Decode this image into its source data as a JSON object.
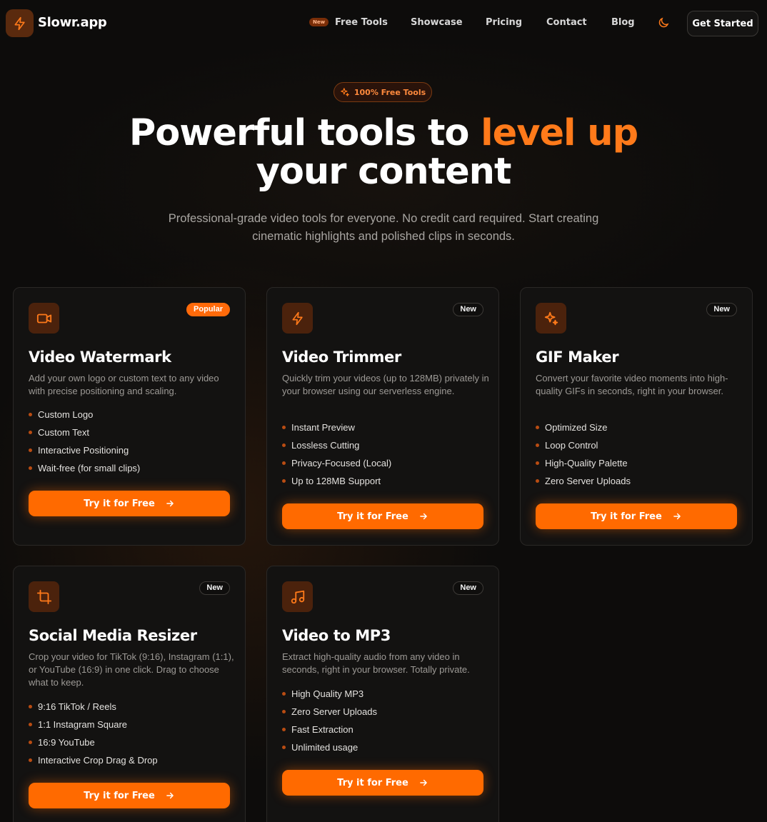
{
  "brand": {
    "name": "Slowr.app",
    "icon": "bolt-icon"
  },
  "nav": {
    "new_badge": "New",
    "links": [
      "Free Tools",
      "Showcase",
      "Pricing",
      "Contact",
      "Blog"
    ],
    "theme_icon": "moon-icon",
    "cta": "Get Started"
  },
  "hero": {
    "badge": "100% Free Tools",
    "title_part1": "Powerful tools to ",
    "title_accent": "level up",
    "title_part2": "your content",
    "subtitle": "Professional-grade video tools for everyone. No credit card required. Start creating cinematic highlights and polished clips in seconds."
  },
  "colors": {
    "accent": "#ff6a00",
    "background": "#0d0c0b",
    "card": "#131211"
  },
  "cards": [
    {
      "icon": "video-camera-icon",
      "badge": "Popular",
      "title": "Video Watermark",
      "description": "Add your own logo or custom text to any video with precise positioning and scaling.",
      "features": [
        "Custom Logo",
        "Custom Text",
        "Interactive Positioning",
        "Wait-free (for small clips)"
      ],
      "cta": "Try it for Free"
    },
    {
      "icon": "bolt-icon",
      "badge": "New",
      "title": "Video Trimmer",
      "description": "Quickly trim your videos (up to 128MB) privately in your browser using our serverless engine.",
      "features": [
        "Instant Preview",
        "Lossless Cutting",
        "Privacy-Focused (Local)",
        "Up to 128MB Support"
      ],
      "cta": "Try it for Free"
    },
    {
      "icon": "sparkles-icon",
      "badge": "New",
      "title": "GIF Maker",
      "description": "Convert your favorite video moments into high-quality GIFs in seconds, right in your browser.",
      "features": [
        "Optimized Size",
        "Loop Control",
        "High-Quality Palette",
        "Zero Server Uploads"
      ],
      "cta": "Try it for Free"
    },
    {
      "icon": "crop-icon",
      "badge": "New",
      "title": "Social Media Resizer",
      "description": "Crop your video for TikTok (9:16), Instagram (1:1), or YouTube (16:9) in one click. Drag to choose what to keep.",
      "features": [
        "9:16 TikTok / Reels",
        "1:1 Instagram Square",
        "16:9 YouTube",
        "Interactive Crop Drag & Drop"
      ],
      "cta": "Try it for Free"
    },
    {
      "icon": "music-note-icon",
      "badge": "New",
      "title": "Video to MP3",
      "description": "Extract high-quality audio from any video in seconds, right in your browser. Totally private.",
      "features": [
        "High Quality MP3",
        "Zero Server Uploads",
        "Fast Extraction",
        "Unlimited usage"
      ],
      "cta": "Try it for Free"
    }
  ]
}
